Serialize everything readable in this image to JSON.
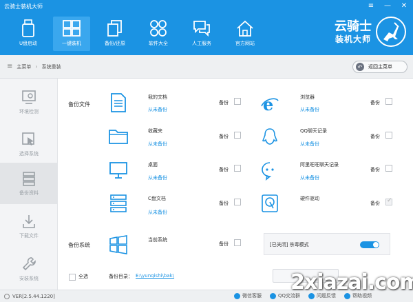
{
  "app": {
    "title": "云骑士装机大师",
    "colors": {
      "primary": "#1b93e3",
      "link": "#1b93e3"
    }
  },
  "window_controls": {
    "menu": "≡",
    "minimize": "—",
    "close": "✕"
  },
  "topnav": [
    {
      "label": "U盘启动",
      "icon": "usb-drive-icon"
    },
    {
      "label": "一键装机",
      "icon": "windows-icon",
      "active": true
    },
    {
      "label": "备份/还原",
      "icon": "copy-icon"
    },
    {
      "label": "软件大全",
      "icon": "apps-grid-icon"
    },
    {
      "label": "人工服务",
      "icon": "chat-icon"
    },
    {
      "label": "官方网站",
      "icon": "home-icon"
    }
  ],
  "logo": {
    "line1": "云骑士",
    "line2": "装机大师"
  },
  "breadcrumb": {
    "menu_icon": "≡",
    "items": [
      "主菜单",
      "系统重装"
    ],
    "separator": "›"
  },
  "back_button": {
    "label": "返回主菜单"
  },
  "sidebar": [
    {
      "label": "环境检测",
      "icon": "monitor-check-icon"
    },
    {
      "label": "选择系统",
      "icon": "cursor-icon"
    },
    {
      "label": "备份资料",
      "icon": "database-icon",
      "active": true
    },
    {
      "label": "下载文件",
      "icon": "download-icon"
    },
    {
      "label": "安装系统",
      "icon": "wrench-icon"
    }
  ],
  "sections": {
    "files": "备份文件",
    "system": "备份系统"
  },
  "backup_items": {
    "my_docs": {
      "title": "我的文档",
      "status": "从未备份",
      "checkbox_label": "备份",
      "checked": false
    },
    "favorites": {
      "title": "收藏夹",
      "status": "从未备份",
      "checkbox_label": "备份",
      "checked": false
    },
    "desktop": {
      "title": "桌面",
      "status": "从未备份",
      "checkbox_label": "备份",
      "checked": false
    },
    "c_docs": {
      "title": "C盘文档",
      "status": "从未备份",
      "checkbox_label": "备份",
      "checked": false
    },
    "browser": {
      "title": "浏览器",
      "status": "从未备份",
      "checkbox_label": "备份",
      "checked": false
    },
    "qq": {
      "title": "QQ聊天记录",
      "status": "从未备份",
      "checkbox_label": "备份",
      "checked": false
    },
    "aliwangwang": {
      "title": "阿里旺旺聊天记录",
      "status": "从未备份",
      "checkbox_label": "备份",
      "checked": false
    },
    "drivers": {
      "title": "硬件驱动",
      "checkbox_label": "备份",
      "checked": true
    },
    "current_system": {
      "title": "当前系统",
      "checkbox_label": "备份",
      "checked": false
    }
  },
  "antivirus": {
    "label": "[已关闭] 杀毒模式",
    "on": true
  },
  "footer": {
    "select_all": "全选",
    "dir_label": "备份目录：",
    "dir_path": "E:\\yunqishi\\bak\\"
  },
  "statusbar": {
    "version": "VER[2.5.44.1220]",
    "links": [
      "微信客服",
      "QQ交流群",
      "问题反馈",
      "帮助视频"
    ]
  },
  "watermark": "2xiazai.com"
}
